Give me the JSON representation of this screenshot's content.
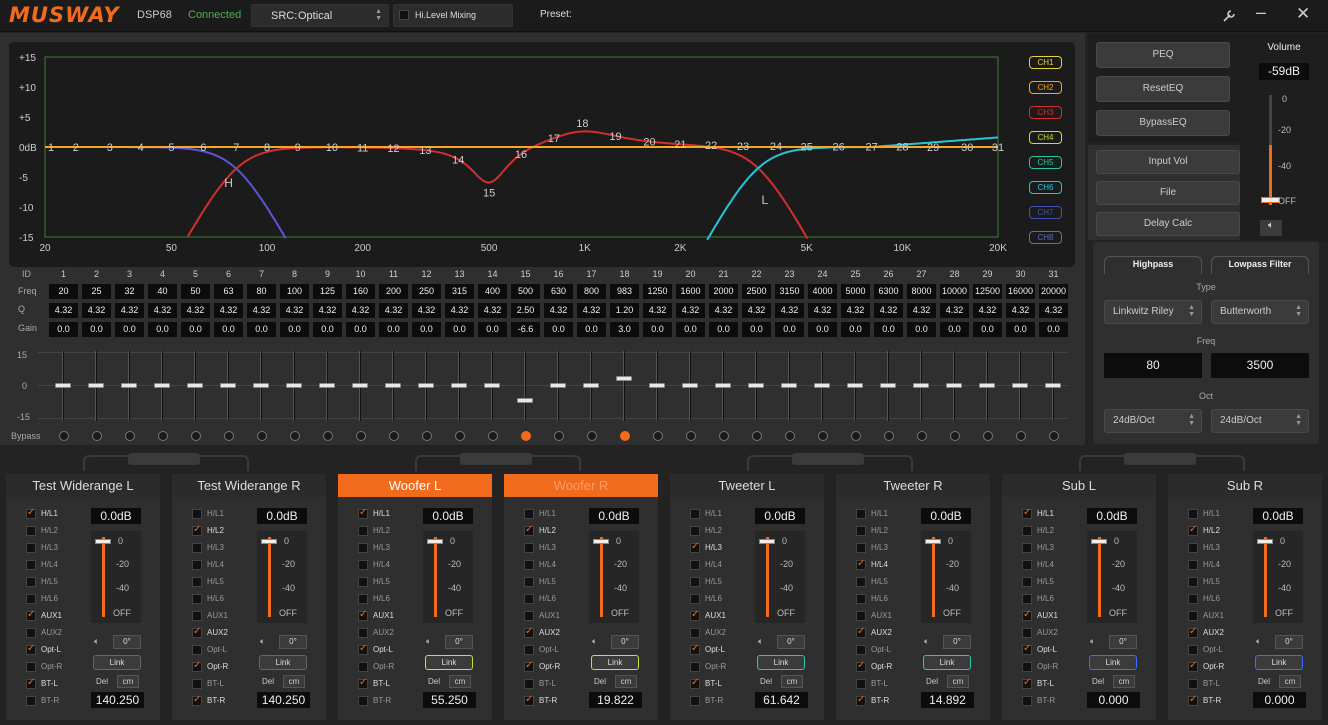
{
  "app": {
    "brand": "MUSWAY",
    "model": "DSP68",
    "status": "Connected",
    "src_label": "SRC:",
    "src_value": "Optical",
    "mixing_label": "Hi.Level Mixing",
    "preset_label": "Preset:"
  },
  "graph": {
    "y_ticks": [
      "+15",
      "+10",
      "+5",
      "0dB",
      "-5",
      "-10",
      "-15"
    ],
    "x_ticks": [
      "20",
      "50",
      "100",
      "200",
      "500",
      "1K",
      "2K",
      "5K",
      "10K",
      "20K"
    ],
    "channels": [
      {
        "label": "CH1",
        "color": "#e8d23a"
      },
      {
        "label": "CH2",
        "color": "#f5a623"
      },
      {
        "label": "CH3",
        "color": "#d32f2f"
      },
      {
        "label": "CH4",
        "color": "#cddc39"
      },
      {
        "label": "CH5",
        "color": "#26c6a6"
      },
      {
        "label": "CH6",
        "color": "#26c6da"
      },
      {
        "label": "CH7",
        "color": "#3f51b5"
      },
      {
        "label": "CH8",
        "color": "#5c6bc0"
      }
    ],
    "markers": {
      "hp": "H",
      "lp": "L"
    }
  },
  "eq": {
    "row_labels": {
      "id": "ID",
      "freq": "Freq",
      "q": "Q",
      "gain": "Gain",
      "bypass": "Bypass"
    },
    "slider_scale": [
      "15",
      "0",
      "-15"
    ],
    "bands": [
      {
        "id": "1",
        "freq": "20",
        "q": "4.32",
        "gain": "0.0",
        "bypass": false
      },
      {
        "id": "2",
        "freq": "25",
        "q": "4.32",
        "gain": "0.0",
        "bypass": false
      },
      {
        "id": "3",
        "freq": "32",
        "q": "4.32",
        "gain": "0.0",
        "bypass": false
      },
      {
        "id": "4",
        "freq": "40",
        "q": "4.32",
        "gain": "0.0",
        "bypass": false
      },
      {
        "id": "5",
        "freq": "50",
        "q": "4.32",
        "gain": "0.0",
        "bypass": false
      },
      {
        "id": "6",
        "freq": "63",
        "q": "4.32",
        "gain": "0.0",
        "bypass": false
      },
      {
        "id": "7",
        "freq": "80",
        "q": "4.32",
        "gain": "0.0",
        "bypass": false
      },
      {
        "id": "8",
        "freq": "100",
        "q": "4.32",
        "gain": "0.0",
        "bypass": false
      },
      {
        "id": "9",
        "freq": "125",
        "q": "4.32",
        "gain": "0.0",
        "bypass": false
      },
      {
        "id": "10",
        "freq": "160",
        "q": "4.32",
        "gain": "0.0",
        "bypass": false
      },
      {
        "id": "11",
        "freq": "200",
        "q": "4.32",
        "gain": "0.0",
        "bypass": false
      },
      {
        "id": "12",
        "freq": "250",
        "q": "4.32",
        "gain": "0.0",
        "bypass": false
      },
      {
        "id": "13",
        "freq": "315",
        "q": "4.32",
        "gain": "0.0",
        "bypass": false
      },
      {
        "id": "14",
        "freq": "400",
        "q": "4.32",
        "gain": "0.0",
        "bypass": false
      },
      {
        "id": "15",
        "freq": "500",
        "q": "2.50",
        "gain": "-6.6",
        "bypass": true
      },
      {
        "id": "16",
        "freq": "630",
        "q": "4.32",
        "gain": "0.0",
        "bypass": false
      },
      {
        "id": "17",
        "freq": "800",
        "q": "4.32",
        "gain": "0.0",
        "bypass": false
      },
      {
        "id": "18",
        "freq": "983",
        "q": "1.20",
        "gain": "3.0",
        "bypass": true
      },
      {
        "id": "19",
        "freq": "1250",
        "q": "4.32",
        "gain": "0.0",
        "bypass": false
      },
      {
        "id": "20",
        "freq": "1600",
        "q": "4.32",
        "gain": "0.0",
        "bypass": false
      },
      {
        "id": "21",
        "freq": "2000",
        "q": "4.32",
        "gain": "0.0",
        "bypass": false
      },
      {
        "id": "22",
        "freq": "2500",
        "q": "4.32",
        "gain": "0.0",
        "bypass": false
      },
      {
        "id": "23",
        "freq": "3150",
        "q": "4.32",
        "gain": "0.0",
        "bypass": false
      },
      {
        "id": "24",
        "freq": "4000",
        "q": "4.32",
        "gain": "0.0",
        "bypass": false
      },
      {
        "id": "25",
        "freq": "5000",
        "q": "4.32",
        "gain": "0.0",
        "bypass": false
      },
      {
        "id": "26",
        "freq": "6300",
        "q": "4.32",
        "gain": "0.0",
        "bypass": false
      },
      {
        "id": "27",
        "freq": "8000",
        "q": "4.32",
        "gain": "0.0",
        "bypass": false
      },
      {
        "id": "28",
        "freq": "10000",
        "q": "4.32",
        "gain": "0.0",
        "bypass": false
      },
      {
        "id": "29",
        "freq": "12500",
        "q": "4.32",
        "gain": "0.0",
        "bypass": false
      },
      {
        "id": "30",
        "freq": "16000",
        "q": "4.32",
        "gain": "0.0",
        "bypass": false
      },
      {
        "id": "31",
        "freq": "20000",
        "q": "4.32",
        "gain": "0.0",
        "bypass": false
      }
    ]
  },
  "right": {
    "buttons": [
      "PEQ",
      "ResetEQ",
      "BypassEQ"
    ],
    "buttons2": [
      "Input Vol",
      "File",
      "Delay Calc"
    ],
    "volume": {
      "title": "Volume",
      "value": "-59dB",
      "scale": [
        "0",
        "-20",
        "-40",
        "OFF"
      ]
    }
  },
  "crossover": {
    "hp_tab": "Highpass",
    "lp_tab": "Lowpass Filter",
    "type_label": "Type",
    "freq_label": "Freq",
    "oct_label": "Oct",
    "hp_type": "Linkwitz Riley",
    "lp_type": "Butterworth",
    "hp_freq": "80",
    "lp_freq": "3500",
    "hp_oct": "24dB/Oct",
    "lp_oct": "24dB/Oct"
  },
  "strip_common": {
    "route_labels": [
      "H/L1",
      "H/L2",
      "H/L3",
      "H/L4",
      "H/L5",
      "H/L6",
      "AUX1",
      "AUX2",
      "Opt-L",
      "Opt-R",
      "BT-L",
      "BT-R"
    ],
    "scale": [
      "0",
      "-20",
      "-40",
      "OFF"
    ],
    "phase": "0°",
    "link": "Link",
    "del": "Del",
    "cm": "cm"
  },
  "strips": [
    {
      "name": "Test Widerange L",
      "db": "0.0dB",
      "delay": "140.250",
      "style": "normal",
      "link_color": "#666",
      "routes": [
        1,
        0,
        0,
        0,
        0,
        0,
        1,
        0,
        1,
        0,
        1,
        0
      ]
    },
    {
      "name": "Test Widerange R",
      "db": "0.0dB",
      "delay": "140.250",
      "style": "normal",
      "link_color": "#666",
      "routes": [
        0,
        1,
        0,
        0,
        0,
        0,
        0,
        1,
        0,
        1,
        0,
        1
      ]
    },
    {
      "name": "Woofer L",
      "db": "0.0dB",
      "delay": "55.250",
      "style": "active",
      "link_color": "#cddc39",
      "routes": [
        1,
        0,
        0,
        0,
        0,
        0,
        1,
        0,
        1,
        0,
        1,
        0
      ]
    },
    {
      "name": "Woofer R",
      "db": "0.0dB",
      "delay": "19.822",
      "style": "warm",
      "link_color": "#cddc39",
      "routes": [
        0,
        1,
        0,
        0,
        0,
        0,
        0,
        1,
        0,
        1,
        0,
        1
      ]
    },
    {
      "name": "Tweeter L",
      "db": "0.0dB",
      "delay": "61.642",
      "style": "normal",
      "link_color": "#26c6a6",
      "routes": [
        0,
        0,
        1,
        0,
        0,
        0,
        1,
        0,
        1,
        0,
        1,
        0
      ]
    },
    {
      "name": "Tweeter R",
      "db": "0.0dB",
      "delay": "14.892",
      "style": "normal",
      "link_color": "#26c6a6",
      "routes": [
        0,
        0,
        0,
        1,
        0,
        0,
        0,
        1,
        0,
        1,
        0,
        1
      ]
    },
    {
      "name": "Sub L",
      "db": "0.0dB",
      "delay": "0.000",
      "style": "normal",
      "link_color": "#3f6bff",
      "routes": [
        1,
        0,
        0,
        0,
        0,
        0,
        1,
        0,
        1,
        0,
        1,
        0
      ]
    },
    {
      "name": "Sub R",
      "db": "0.0dB",
      "delay": "0.000",
      "style": "normal",
      "link_color": "#3f6bff",
      "routes": [
        0,
        1,
        0,
        0,
        0,
        0,
        0,
        1,
        0,
        1,
        0,
        1
      ]
    }
  ]
}
